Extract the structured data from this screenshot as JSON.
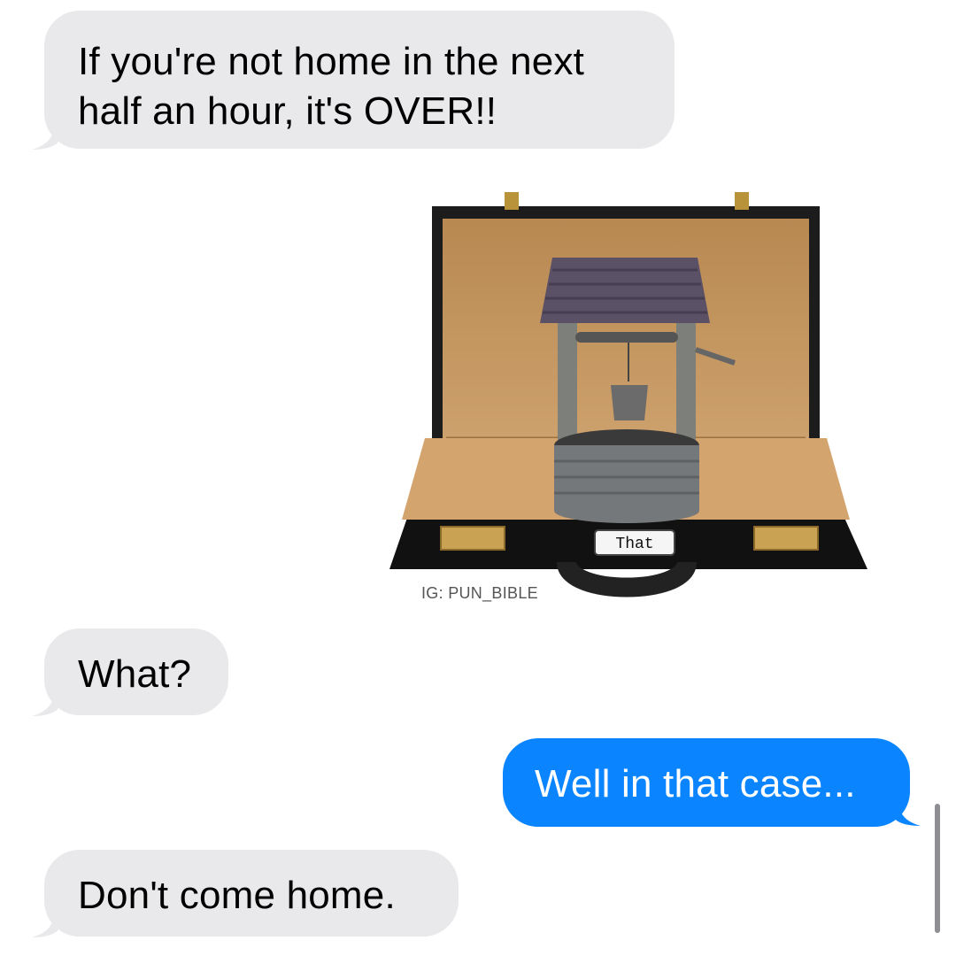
{
  "conversation": {
    "messages": [
      {
        "sender": "incoming",
        "text": "If you're not home in the next\nhalf an hour, it's OVER!!"
      },
      {
        "sender": "incoming",
        "type": "image",
        "caption": "IG: PUN_BIBLE",
        "tag_label": "That",
        "content": "briefcase containing a wishing well"
      },
      {
        "sender": "incoming",
        "text": "What?"
      },
      {
        "sender": "outgoing",
        "text": "Well in that case..."
      },
      {
        "sender": "incoming",
        "text": "Don't come home."
      }
    ]
  },
  "colors": {
    "incoming_bubble": "#e9e9eb",
    "outgoing_bubble": "#0a84ff",
    "text_dark": "#000000",
    "text_light": "#ffffff"
  }
}
